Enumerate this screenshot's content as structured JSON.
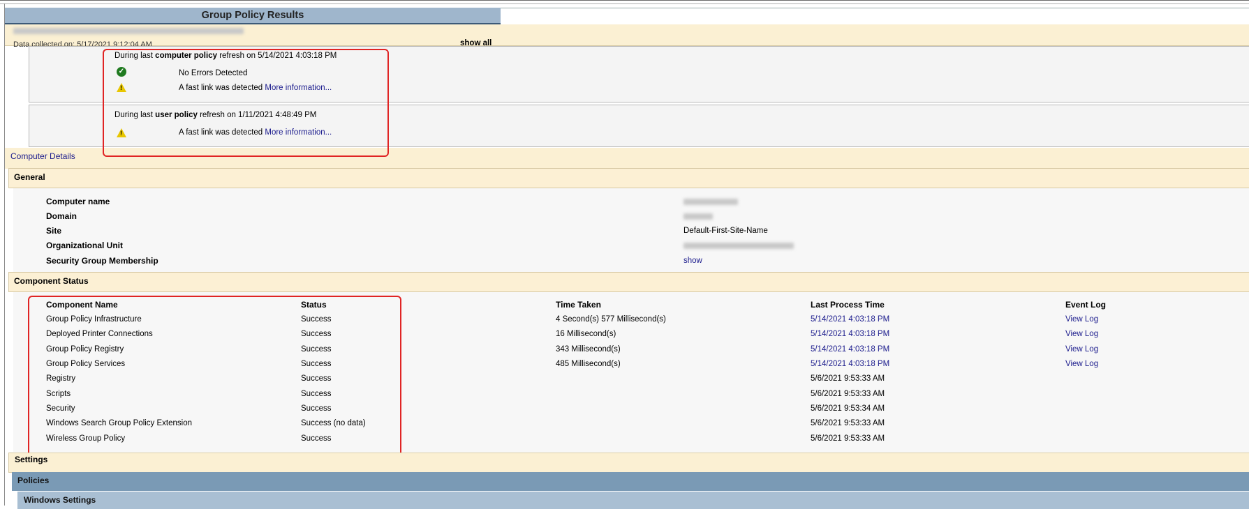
{
  "report": {
    "title": "Group Policy Results",
    "collected_label": "Data collected on: 5/17/2021 9:12:04 AM",
    "show_all": "show all"
  },
  "computer_refresh": {
    "prefix": "During last ",
    "policy": "computer policy",
    "suffix": " refresh on 5/14/2021 4:03:18 PM",
    "messages": [
      {
        "icon": "check-icon",
        "text": "No Errors Detected",
        "link": ""
      },
      {
        "icon": "warning-icon",
        "text": "A fast link was detected ",
        "link": "More information..."
      }
    ]
  },
  "user_refresh": {
    "prefix": "During last ",
    "policy": "user policy",
    "suffix": " refresh on 1/11/2021 4:48:49 PM",
    "messages": [
      {
        "icon": "warning-icon",
        "text": "A fast link was detected ",
        "link": "More information..."
      }
    ]
  },
  "computer_details": {
    "heading": "Computer Details",
    "general": {
      "heading": "General",
      "rows": [
        {
          "label": "Computer name",
          "value": ""
        },
        {
          "label": "Domain",
          "value": ""
        },
        {
          "label": "Site",
          "value": "Default-First-Site-Name"
        },
        {
          "label": "Organizational Unit",
          "value": ""
        },
        {
          "label": "Security Group Membership",
          "value": "show"
        }
      ]
    },
    "component_status": {
      "heading": "Component Status",
      "columns": [
        "Component Name",
        "Status",
        "Time Taken",
        "Last Process Time",
        "Event Log"
      ],
      "rows": [
        {
          "name": "Group Policy Infrastructure",
          "status": "Success",
          "time": "4 Second(s) 577 Millisecond(s)",
          "last": "5/14/2021 4:03:18 PM",
          "last_link": true,
          "log": "View Log"
        },
        {
          "name": "Deployed Printer Connections",
          "status": "Success",
          "time": "16 Millisecond(s)",
          "last": "5/14/2021 4:03:18 PM",
          "last_link": true,
          "log": "View Log"
        },
        {
          "name": "Group Policy Registry",
          "status": "Success",
          "time": "343 Millisecond(s)",
          "last": "5/14/2021 4:03:18 PM",
          "last_link": true,
          "log": "View Log"
        },
        {
          "name": "Group Policy Services",
          "status": "Success",
          "time": "485 Millisecond(s)",
          "last": "5/14/2021 4:03:18 PM",
          "last_link": true,
          "log": "View Log"
        },
        {
          "name": "Registry",
          "status": "Success",
          "time": "",
          "last": "5/6/2021 9:53:33 AM",
          "last_link": false,
          "log": ""
        },
        {
          "name": "Scripts",
          "status": "Success",
          "time": "",
          "last": "5/6/2021 9:53:33 AM",
          "last_link": false,
          "log": ""
        },
        {
          "name": "Security",
          "status": "Success",
          "time": "",
          "last": "5/6/2021 9:53:34 AM",
          "last_link": false,
          "log": ""
        },
        {
          "name": "Windows Search Group Policy Extension",
          "status": "Success (no data)",
          "time": "",
          "last": "5/6/2021 9:53:33 AM",
          "last_link": false,
          "log": ""
        },
        {
          "name": "Wireless Group Policy",
          "status": "Success",
          "time": "",
          "last": "5/6/2021 9:53:33 AM",
          "last_link": false,
          "log": ""
        }
      ]
    },
    "settings": "Settings",
    "policies": "Policies",
    "windows_settings": "Windows Settings"
  },
  "colors": {
    "title_bar": "#9fb6cc",
    "band": "#fbf0d3",
    "link": "#1a1a8c",
    "highlight": "#e02424",
    "policies_band": "#7a9ab5"
  }
}
